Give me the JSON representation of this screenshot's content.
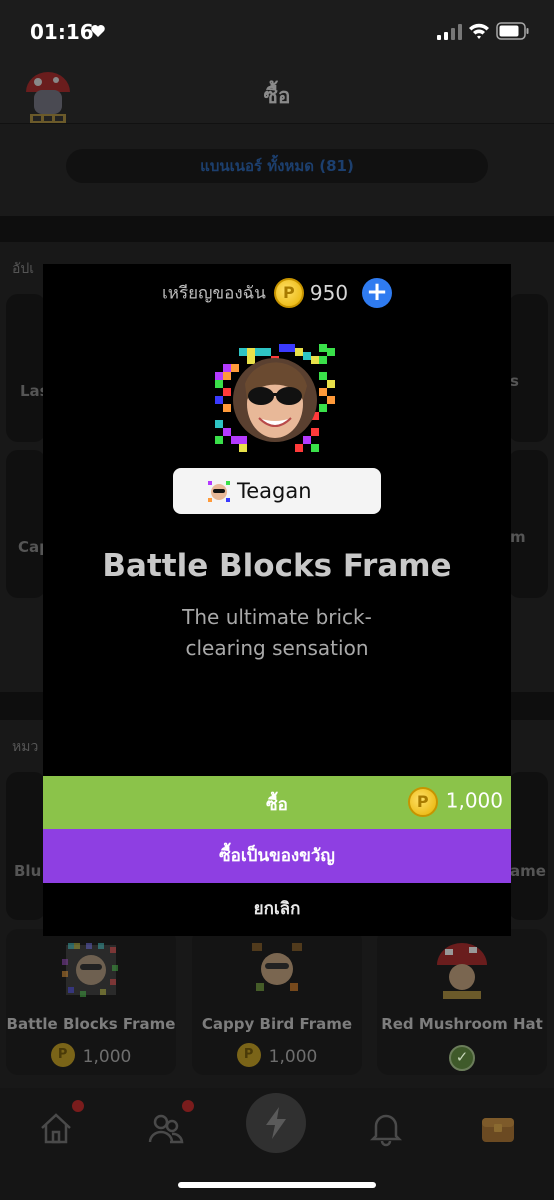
{
  "status_bar": {
    "time": "01:16"
  },
  "header": {
    "title": "ซื้อ"
  },
  "banner": {
    "label": "แบนเนอร์ ทั้งหมด (81)"
  },
  "background": {
    "section1_label": "อัปเ",
    "section2_label": "หมว",
    "partial_cards": [
      "Las",
      "s",
      "Cap",
      "m",
      "Blu",
      "ame"
    ]
  },
  "shop_items": [
    {
      "name": "Battle Blocks Frame",
      "price": "1,000",
      "owned": false
    },
    {
      "name": "Cappy Bird Frame",
      "price": "1,000",
      "owned": false
    },
    {
      "name": "Red Mushroom Hat",
      "price": "",
      "owned": true
    }
  ],
  "modal": {
    "coins_label": "เหรียญของฉัน",
    "coin_balance": "950",
    "username": "Teagan",
    "product_title": "Battle Blocks Frame",
    "product_description": "The ultimate brick-clearing sensation",
    "buy_label": "ซื้อ",
    "buy_price": "1,000",
    "gift_label": "ซื้อเป็นของขวัญ",
    "cancel_label": "ยกเลิก"
  },
  "tabbar": {
    "tabs": [
      {
        "name": "home",
        "icon": "home-icon",
        "badge": true
      },
      {
        "name": "friends",
        "icon": "friends-icon",
        "badge": true
      },
      {
        "name": "play",
        "icon": "lightning-icon",
        "badge": false
      },
      {
        "name": "notifications",
        "icon": "bell-icon",
        "badge": false
      },
      {
        "name": "shop",
        "icon": "treasure-chest-icon",
        "badge": false
      }
    ]
  },
  "colors": {
    "buy_green": "#8bc34a",
    "gift_purple": "#8e3fe2",
    "coin_gold": "#f2c200",
    "plus_blue": "#2f7bf0"
  }
}
